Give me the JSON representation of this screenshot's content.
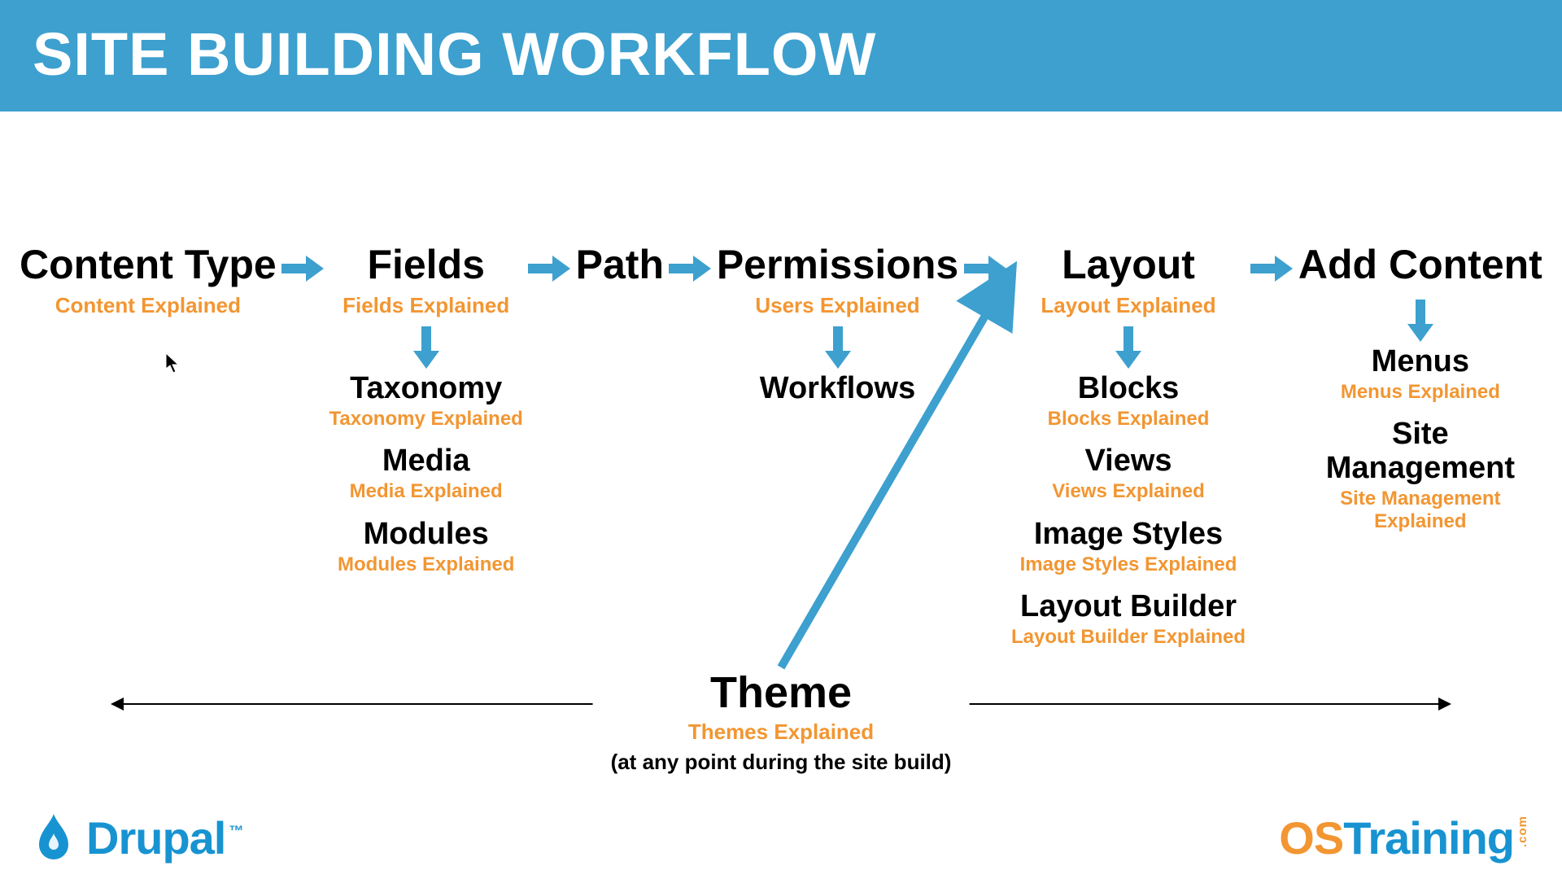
{
  "title": "SITE BUILDING WORKFLOW",
  "steps": [
    {
      "title": "Content Type",
      "sub": "Content Explained"
    },
    {
      "title": "Fields",
      "sub": "Fields Explained"
    },
    {
      "title": "Path",
      "sub": ""
    },
    {
      "title": "Permissions",
      "sub": "Users Explained"
    },
    {
      "title": "Layout",
      "sub": "Layout Explained"
    },
    {
      "title": "Add Content",
      "sub": ""
    }
  ],
  "fields_children": [
    {
      "label": "Taxonomy",
      "expl": "Taxonomy Explained"
    },
    {
      "label": "Media",
      "expl": "Media Explained"
    },
    {
      "label": "Modules",
      "expl": "Modules Explained"
    }
  ],
  "permissions_children": [
    {
      "label": "Workflows",
      "expl": ""
    }
  ],
  "layout_children": [
    {
      "label": "Blocks",
      "expl": "Blocks Explained"
    },
    {
      "label": "Views",
      "expl": "Views Explained"
    },
    {
      "label": "Image Styles",
      "expl": "Image Styles Explained"
    },
    {
      "label": "Layout Builder",
      "expl": "Layout Builder Explained"
    }
  ],
  "addcontent_children": [
    {
      "label": "Menus",
      "expl": "Menus Explained"
    },
    {
      "label": "Site Management",
      "expl": "Site Management Explained",
      "wrap": true
    }
  ],
  "theme": {
    "label": "Theme",
    "expl": "Themes Explained",
    "note": "(at any point during the site build)"
  },
  "footer": {
    "drupal": "Drupal",
    "tm": "™",
    "os1": "OS",
    "os2": "Training",
    "osvert": ".com"
  }
}
